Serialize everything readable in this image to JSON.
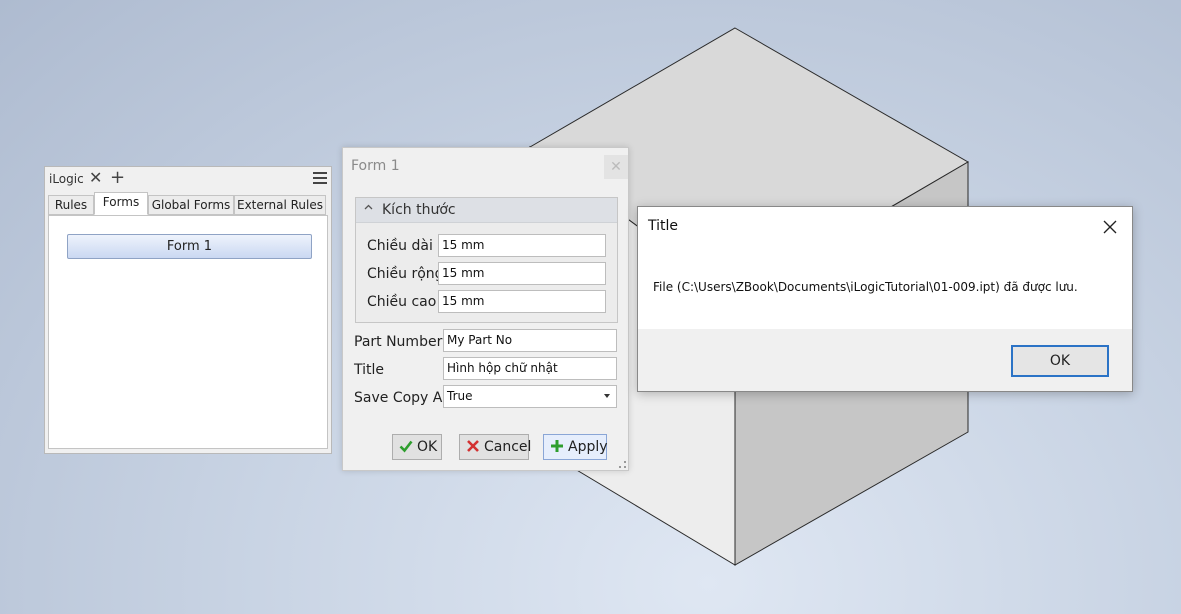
{
  "ilogic_panel": {
    "title": "iLogic",
    "close_glyph": "✕",
    "add_glyph": "+",
    "menu_icon": "hamburger-menu-icon",
    "tabs": [
      {
        "label": "Rules",
        "active": false
      },
      {
        "label": "Forms",
        "active": true
      },
      {
        "label": "Global Forms",
        "active": false
      },
      {
        "label": "External Rules",
        "active": false
      }
    ],
    "forms": [
      {
        "label": "Form 1"
      }
    ]
  },
  "form_dialog": {
    "title": "Form 1",
    "close_glyph": "✕",
    "group": {
      "label": "Kích thước",
      "collapse_glyph": "^",
      "fields": [
        {
          "label": "Chiều dài",
          "value": "15 mm"
        },
        {
          "label": "Chiều rộng",
          "value": "15 mm"
        },
        {
          "label": "Chiều cao",
          "value": "15 mm"
        }
      ]
    },
    "fields": [
      {
        "label": "Part Number",
        "value": "My Part No"
      },
      {
        "label": "Title",
        "value": "Hình hộp chữ nhật"
      }
    ],
    "save_copy_as": {
      "label": "Save Copy As",
      "value": "True"
    },
    "buttons": {
      "ok": "OK",
      "cancel": "Cancel",
      "apply": "Apply"
    },
    "colors": {
      "ok_icon": "#2e9e2e",
      "cancel_icon": "#d33030",
      "apply_icon": "#2e9e2e"
    }
  },
  "message_box": {
    "title": "Title",
    "message": "File (C:\\Users\\ZBook\\Documents\\iLogicTutorial\\01-009.ipt) đã được lưu.",
    "ok_label": "OK",
    "accent": "#2b73c6"
  }
}
